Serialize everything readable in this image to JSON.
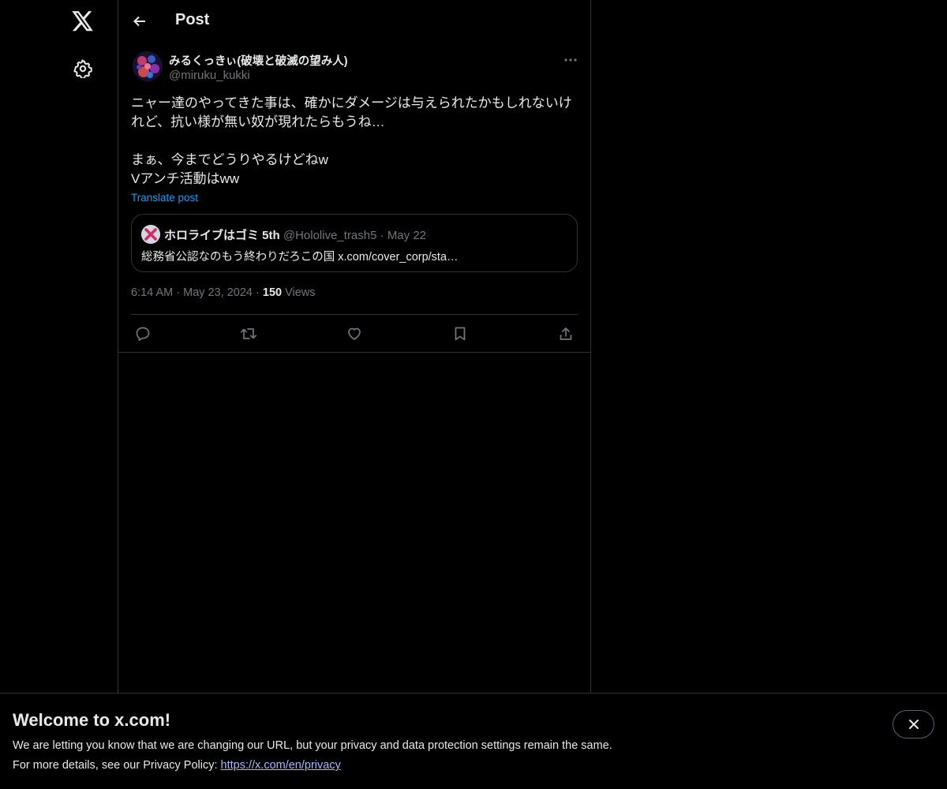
{
  "nav": {
    "logo_icon": "x-logo-icon",
    "settings_icon": "gear-icon"
  },
  "header": {
    "back_icon": "arrow-left-icon",
    "title": "Post"
  },
  "post": {
    "author_name": "みるくっきぃ(破壊と破滅の望み人)",
    "author_handle": "@miruku_kukki",
    "more_icon": "ellipsis-icon",
    "text_lines": [
      "ニャー達のやってきた事は、確かにダメージは与えられたかもしれないけ",
      "れど、抗い様が無い奴が現れたらもうね…",
      "",
      "まぁ、今までどうりやるけどねw",
      "Vアンチ活動はww"
    ],
    "translate_label": "Translate post",
    "quote": {
      "name": "ホロライブはゴミ 5th",
      "handle": "@Hololive_trash5",
      "dot": "·",
      "date": "May 22",
      "text": "総務省公認なのもう終わりだろこの国 x.com/cover_corp/sta…"
    },
    "time": "6:14 AM",
    "sep1": "·",
    "date": "May 23, 2024",
    "sep2": "·",
    "views_count": "150",
    "views_label": "Views",
    "actions": [
      "reply-icon",
      "repost-icon",
      "like-icon",
      "bookmark-icon",
      "share-icon"
    ]
  },
  "banner": {
    "title": "Welcome to x.com!",
    "line1": "We are letting you know that we are changing our URL, but your privacy and data protection settings remain the same.",
    "line2_prefix": "For more details, see our Privacy Policy: ",
    "link": "https://x.com/en/privacy",
    "close_icon": "close-icon"
  },
  "colors": {
    "background": "#000000",
    "text": "#e7e9ea",
    "secondary_text": "#71767b",
    "accent": "#1d9bf0",
    "border": "#2f3336",
    "link": "#a6b8ff"
  }
}
